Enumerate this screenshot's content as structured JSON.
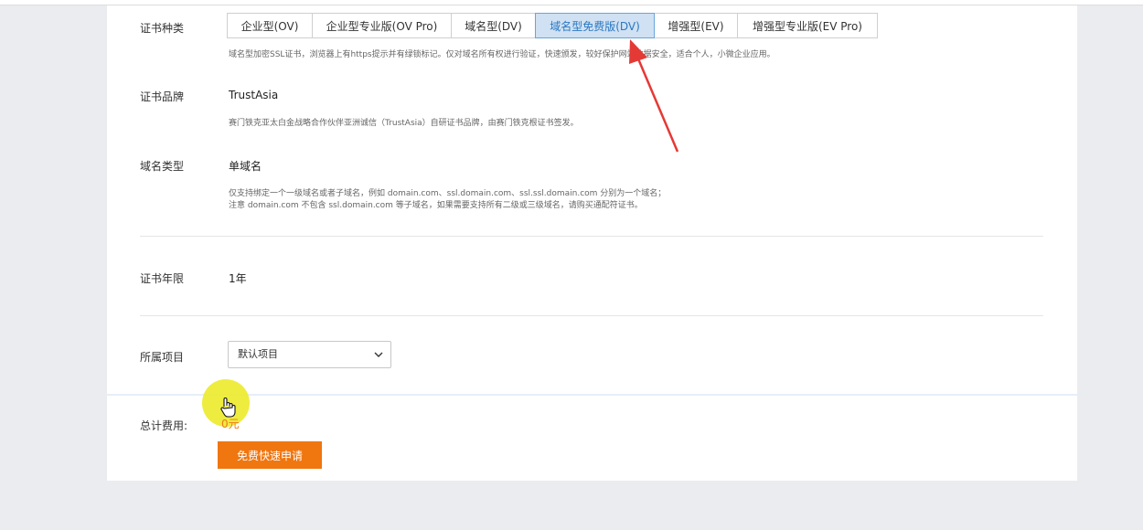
{
  "form": {
    "cert_type": {
      "label": "证书种类",
      "options": [
        "企业型(OV)",
        "企业型专业版(OV Pro)",
        "域名型(DV)",
        "域名型免费版(DV)",
        "增强型(EV)",
        "增强型专业版(EV Pro)"
      ],
      "selected": "域名型免费版(DV)",
      "description": "域名型加密SSL证书，浏览器上有https提示并有绿锁标记。仅对域名所有权进行验证，快速颁发，较好保护网站数据安全，适合个人，小微企业应用。"
    },
    "brand": {
      "label": "证书品牌",
      "value": "TrustAsia",
      "description": "赛门铁克亚太白金战略合作伙伴亚洲诚信（TrustAsia）自研证书品牌，由赛门铁克根证书签发。"
    },
    "domain_type": {
      "label": "域名类型",
      "value": "单域名",
      "description_line1": "仅支持绑定一个一级域名或者子域名，例如 domain.com、ssl.domain.com、ssl.ssl.domain.com 分别为一个域名；",
      "description_line2": "注意 domain.com 不包含 ssl.domain.com 等子域名，如果需要支持所有二级或三级域名，请购买通配符证书。"
    },
    "period": {
      "label": "证书年限",
      "value": "1年"
    },
    "project": {
      "label": "所属项目",
      "value": "默认项目"
    }
  },
  "footer": {
    "total_label": "总计费用:",
    "price": "0",
    "currency": "元",
    "apply_button": "免费快速申请"
  },
  "colors": {
    "accent_orange": "#f0760f",
    "selected_tab_bg": "#cfe1f3",
    "selected_tab_text": "#2b78c2",
    "annotation_arrow": "#e53935"
  }
}
